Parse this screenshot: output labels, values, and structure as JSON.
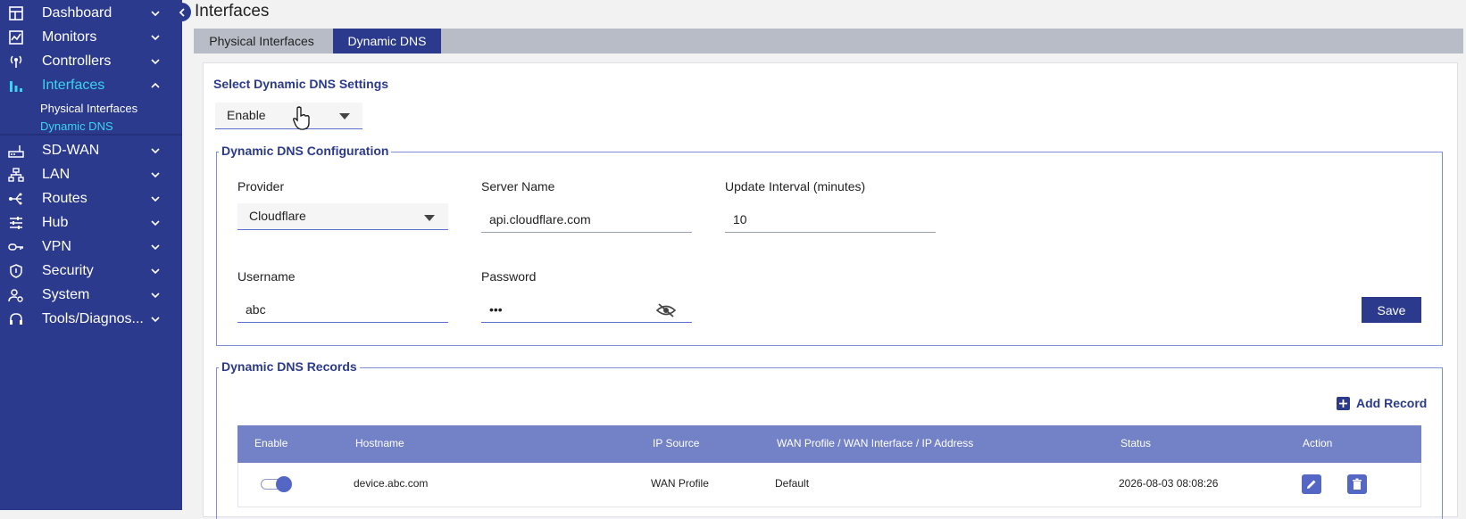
{
  "sidebar": {
    "items": [
      {
        "label": "Dashboard",
        "icon": "dashboard-icon"
      },
      {
        "label": "Monitors",
        "icon": "monitor-chart-icon"
      },
      {
        "label": "Controllers",
        "icon": "antenna-icon"
      },
      {
        "label": "Interfaces",
        "icon": "bar-chart-icon",
        "active": true
      },
      {
        "label": "SD-WAN",
        "icon": "router-icon"
      },
      {
        "label": "LAN",
        "icon": "network-icon"
      },
      {
        "label": "Routes",
        "icon": "routes-icon"
      },
      {
        "label": "Hub",
        "icon": "sliders-icon"
      },
      {
        "label": "VPN",
        "icon": "key-icon"
      },
      {
        "label": "Security",
        "icon": "shield-icon"
      },
      {
        "label": "System",
        "icon": "user-settings-icon"
      },
      {
        "label": "Tools/Diagnos...",
        "icon": "headset-icon"
      }
    ],
    "sub_items": [
      {
        "label": "Physical Interfaces"
      },
      {
        "label": "Dynamic DNS",
        "active": true
      }
    ],
    "active_color": "#3ad3f2",
    "background": "#2b3a8c"
  },
  "header": {
    "title": "Interfaces"
  },
  "tabs": [
    {
      "label": "Physical Interfaces",
      "active": false
    },
    {
      "label": "Dynamic DNS",
      "active": true
    }
  ],
  "settings": {
    "title": "Select Dynamic DNS Settings",
    "mode_value": "Enable"
  },
  "config": {
    "title": "Dynamic DNS Configuration",
    "provider_label": "Provider",
    "provider_value": "Cloudflare",
    "server_label": "Server Name",
    "server_value": "api.cloudflare.com",
    "interval_label": "Update Interval (minutes)",
    "interval_value": "10",
    "username_label": "Username",
    "username_value": "abc",
    "password_label": "Password",
    "password_value": "•••",
    "save_label": "Save"
  },
  "records": {
    "title": "Dynamic DNS Records",
    "add_label": "Add Record",
    "columns": [
      "Enable",
      "Hostname",
      "IP Source",
      "WAN Profile / WAN Interface / IP Address",
      "Status",
      "Action"
    ],
    "rows": [
      {
        "enabled": true,
        "hostname": "device.abc.com",
        "ip_source": "WAN Profile",
        "wan": "Default",
        "status": "2026-08-03 08:08:26"
      }
    ]
  },
  "colors": {
    "accent": "#2b3a8c",
    "table_header": "#7382c6",
    "action_button": "#5567c4"
  }
}
